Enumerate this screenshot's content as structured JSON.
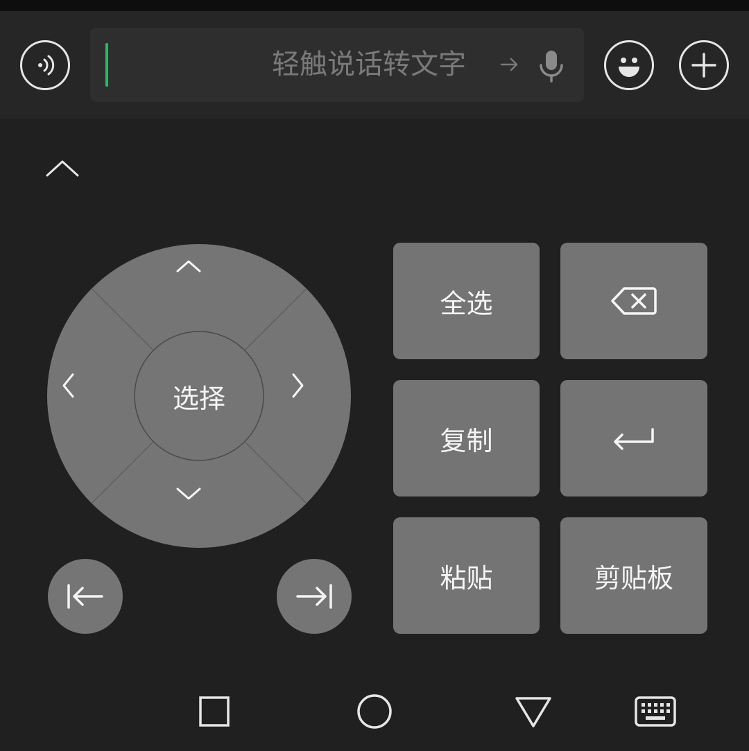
{
  "input": {
    "placeholder": "轻触说话转文字",
    "value": ""
  },
  "icons": {
    "voice": "voice-mode-icon",
    "arrow": "arrow-right-icon",
    "mic": "microphone-icon",
    "emoji": "emoji-icon",
    "plus": "plus-icon",
    "collapse": "chevron-up-icon",
    "up": "dpad-up-icon",
    "down": "dpad-down-icon",
    "left": "dpad-left-icon",
    "right": "dpad-right-icon",
    "line_start": "move-to-line-start-icon",
    "line_end": "move-to-line-end-icon",
    "backspace": "backspace-icon",
    "enter": "enter-icon",
    "nav_recents": "square-icon",
    "nav_home": "circle-icon",
    "nav_back": "triangle-icon",
    "nav_keyboard": "keyboard-icon"
  },
  "dpad": {
    "center_label": "选择"
  },
  "keys": {
    "select_all": "全选",
    "copy": "复制",
    "paste": "粘贴",
    "clipboard": "剪贴板"
  },
  "colors": {
    "background": "#202020",
    "key": "#747474",
    "cursor": "#1fbf5f",
    "icon": "#e6e6e6"
  }
}
